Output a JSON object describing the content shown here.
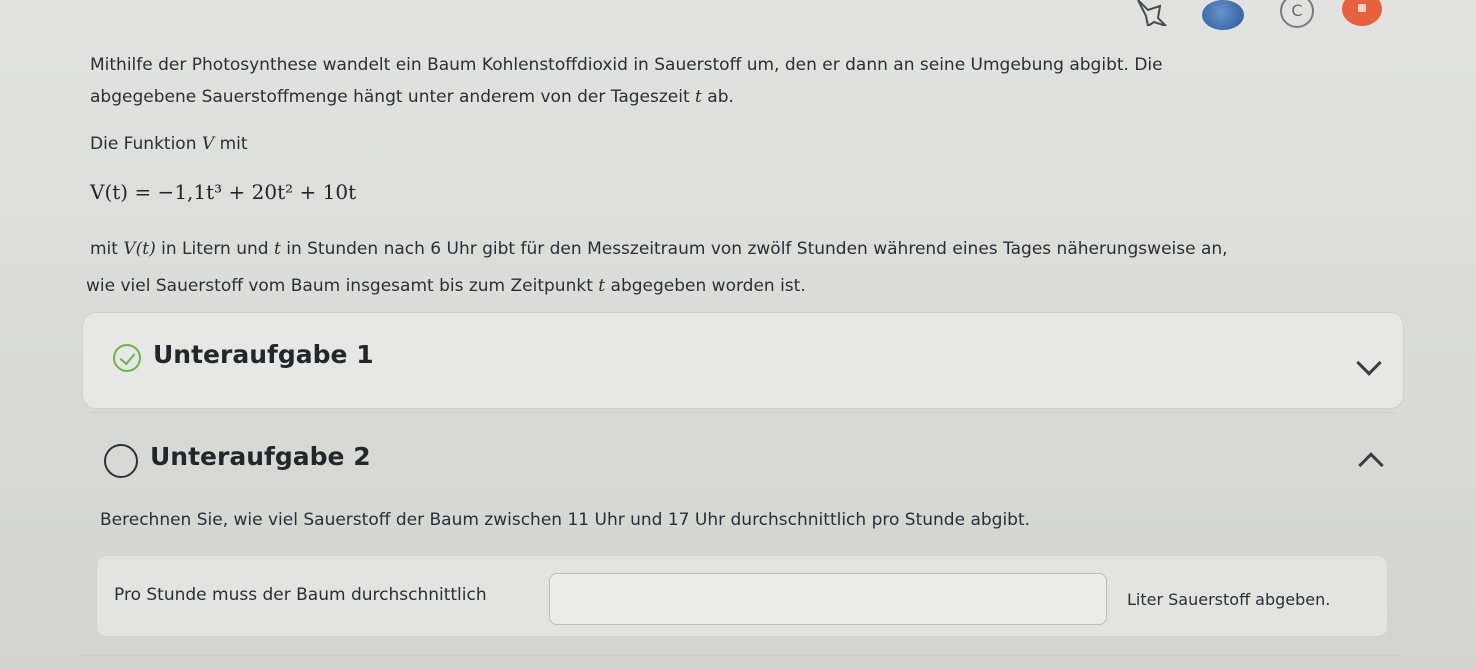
{
  "intro": {
    "line1": "Mithilfe der Photosynthese wandelt ein Baum Kohlenstoffdioxid in Sauerstoff um, den er dann an seine Umgebung abgibt. Die",
    "line2_pre": "abgegebene Sauerstoffmenge hängt unter anderem von der Tageszeit ",
    "line2_var": "t",
    "line2_post": " ab.",
    "function_pre": "Die Funktion ",
    "function_var": "V",
    "function_post": " mit",
    "formula": "V(t) = −1,1t³ + 20t² + 10t",
    "desc1_pre": "mit ",
    "desc1_var": "V(t)",
    "desc1_mid": " in Litern und ",
    "desc1_var2": "t",
    "desc1_post": " in Stunden nach 6 Uhr gibt für den Messzeitraum von zwölf Stunden während eines Tages näherungsweise an,",
    "desc2_pre": "wie viel Sauerstoff vom Baum insgesamt bis zum Zeitpunkt ",
    "desc2_var": "t",
    "desc2_post": " abgegeben worden ist."
  },
  "subtasks": [
    {
      "title": "Unteraufgabe 1",
      "status": "completed",
      "expanded": false
    },
    {
      "title": "Unteraufgabe 2",
      "status": "open",
      "expanded": true
    }
  ],
  "task2": {
    "question": "Berechnen Sie, wie viel Sauerstoff der Baum zwischen 11 Uhr und 17 Uhr durchschnittlich pro Stunde abgibt.",
    "answer_lead": "Pro Stunde muss der Baum durchschnittlich",
    "answer_value": "",
    "answer_tail": "Liter Sauerstoff abgeben."
  },
  "top_icons": [
    "star-icon",
    "globe-icon",
    "copyright-icon",
    "flag-icon"
  ],
  "colors": {
    "check": "#6fb04a",
    "flag": "#e8603f",
    "globe": "#3f6fae"
  }
}
